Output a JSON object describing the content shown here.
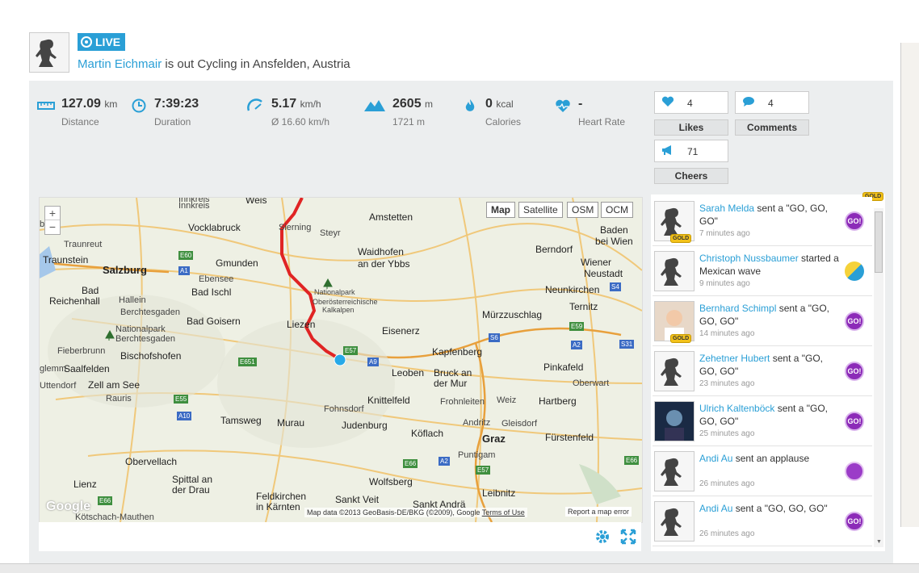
{
  "header": {
    "live_label": "LIVE",
    "user_name": "Martin Eichmair",
    "activity_text": " is out Cycling in Ansfelden, Austria"
  },
  "stats": [
    {
      "value": "127.09",
      "unit": "km",
      "label": "Distance",
      "icon": "ruler-icon"
    },
    {
      "value": "7:39:23",
      "unit": "",
      "label": "Duration",
      "icon": "clock-icon"
    },
    {
      "value": "5.17",
      "unit": "km/h",
      "label": "Ø 16.60 km/h",
      "icon": "speedometer-icon"
    },
    {
      "value": "2605",
      "unit": "m",
      "label": "1721 m",
      "icon": "mountain-icon"
    },
    {
      "value": "0",
      "unit": "kcal",
      "label": "Calories",
      "icon": "flame-icon"
    },
    {
      "value": "-",
      "unit": "",
      "label": "Heart Rate",
      "icon": "heart-rate-icon"
    }
  ],
  "social": {
    "likes_count": "4",
    "likes_label": "Likes",
    "comments_count": "4",
    "comments_label": "Comments",
    "cheers_count": "71",
    "cheers_label": "Cheers"
  },
  "map": {
    "types": [
      "Map",
      "Satellite",
      "OSM",
      "OCM"
    ],
    "active_type": "Map",
    "zoom_in": "+",
    "zoom_out": "−",
    "attribution": "Map data ©2013 GeoBasis-DE/BKG (©2009), Google",
    "terms": "Terms of Use",
    "report": "Report a map error",
    "google": "Google",
    "places": {
      "weis": "Weis",
      "steyr": "Steyr",
      "amstetten": "Amstetten",
      "innkreis": "Innkreis",
      "vocklabruck": "Vocklabruck",
      "sierning": "Sierning",
      "baden": "Baden",
      "beiwien": "bei Wien",
      "traunreut": "Traunreut",
      "traunstein": "Traunstein",
      "salzburg": "Salzburg",
      "gmunden": "Gmunden",
      "waidhofen": "Waidhofen",
      "anderybbs": "an der Ybbs",
      "berndorf": "Berndorf",
      "wiener": "Wiener",
      "neustadt": "Neustadt",
      "ebensee": "Ebensee",
      "badischl": "Bad Ischl",
      "bad": "Bad",
      "reichenhall": "Reichenhall",
      "hallein": "Hallein",
      "nationalpark1": "Nationalpark",
      "oberost": "Oberösterreichische",
      "kalkalpen": "Kalkalpen",
      "neunkirchen": "Neunkirchen",
      "berchtesgaden": "Berchtesgaden",
      "badgoisern": "Bad Goisern",
      "liezen": "Liezen",
      "murzzuschlag": "Mürzzuschlag",
      "ternitz": "Ternitz",
      "nationalpark2": "Nationalpark",
      "berchtesgaden2": "Berchtesgaden",
      "eisenerz": "Eisenerz",
      "fieberbrunn": "Fieberbrunn",
      "bischofshofen": "Bischofshofen",
      "kapfenberg": "Kapfenberg",
      "saalfelden": "Saalfelden",
      "leoben": "Leoben",
      "bruckander": "Bruck an",
      "dermur": "der Mur",
      "pinkafeld": "Pinkafeld",
      "zellamsee": "Zell am See",
      "oberwart": "Oberwart",
      "uttendorf": "Uttendorf",
      "rauris": "Rauris",
      "knittelfeld": "Knittelfeld",
      "frohnleiten": "Frohnleiten",
      "weiz": "Weiz",
      "hartberg": "Hartberg",
      "fohnsdorf": "Fohnsdorf",
      "tamsweg": "Tamsweg",
      "murau": "Murau",
      "judenburg": "Judenburg",
      "andritz": "Andritz",
      "gleisdorf": "Gleisdorf",
      "koflach": "Köflach",
      "graz": "Graz",
      "furstenfeld": "Fürstenfeld",
      "obervellach": "Obervellach",
      "puntigam": "Puntigam",
      "spittal": "Spittal an",
      "derdrau": "der Drau",
      "lienz": "Lienz",
      "wolfsberg": "Wolfsberg",
      "feldkirchen": "Feldkirchen",
      "inkarnten": "in Kärnten",
      "sanktveit": "Sankt Veit",
      "sanktandra": "Sankt Andrä",
      "leibnitz": "Leibnitz",
      "kotschach": "Kötschach-Mauthen",
      "glemm": "glemm",
      "berg": "berg"
    },
    "roads": [
      "E60",
      "A1",
      "E57",
      "A9",
      "E651",
      "S6",
      "E59",
      "A2",
      "S31",
      "S4",
      "E55",
      "A10",
      "E66",
      "A2",
      "E57",
      "E66",
      "E66"
    ]
  },
  "feed": [
    {
      "who": "Sarah Melda",
      "what": " sent a \"GO, GO, GO\"",
      "ago": "7 minutes ago",
      "badge": "go-badge-icon",
      "gold": "GOLD"
    },
    {
      "who": "Christoph Nussbaumer",
      "what": " started a Mexican wave",
      "ago": "9 minutes ago",
      "badge": "wave-badge-icon",
      "gold": ""
    },
    {
      "who": "Bernhard Schimpl",
      "what": " sent a \"GO, GO, GO\"",
      "ago": "14 minutes ago",
      "badge": "go-badge-icon",
      "gold": "GOLD"
    },
    {
      "who": "Zehetner Hubert",
      "what": " sent a \"GO, GO, GO\"",
      "ago": "23 minutes ago",
      "badge": "go-badge-icon",
      "gold": ""
    },
    {
      "who": "Ulrich Kaltenböck",
      "what": " sent a \"GO, GO, GO\"",
      "ago": "25 minutes ago",
      "badge": "go-badge-icon",
      "gold": ""
    },
    {
      "who": "Andi Au",
      "what": " sent an applause",
      "ago": "26 minutes ago",
      "badge": "applause-badge-icon",
      "gold": ""
    },
    {
      "who": "Andi Au",
      "what": " sent a \"GO, GO, GO\"",
      "ago": "26 minutes ago",
      "badge": "go-badge-icon",
      "gold": ""
    }
  ],
  "feed_top_gold": "GOLD",
  "go_text": "GO!",
  "colors": {
    "accent": "#2a9fd6",
    "route": "#e02424",
    "go_badge": "#8c2bb8"
  }
}
